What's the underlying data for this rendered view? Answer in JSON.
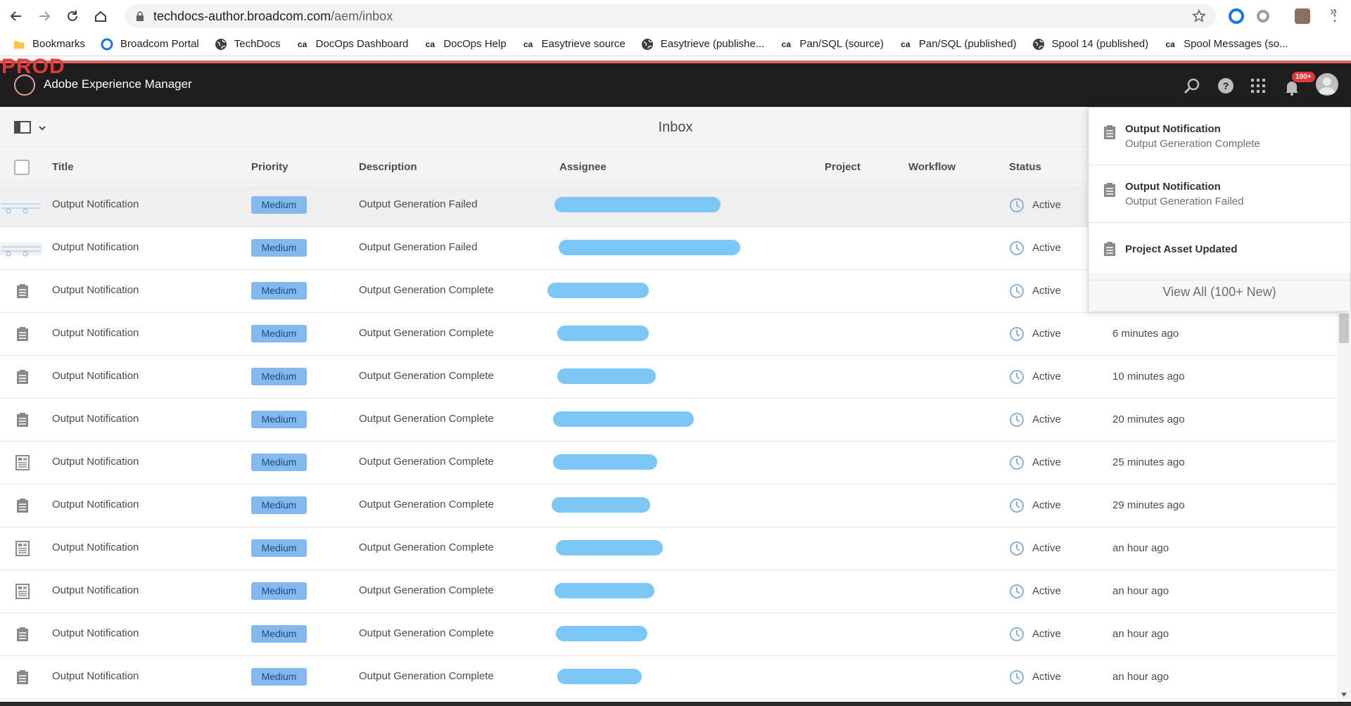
{
  "browser": {
    "url_host": "techdocs-author.broadcom.com",
    "url_path": "/aem/inbox",
    "bookmarks": [
      {
        "label": "Bookmarks",
        "icon": "folder-icon"
      },
      {
        "label": "Broadcom Portal",
        "icon": "broadcom-icon"
      },
      {
        "label": "TechDocs",
        "icon": "globe-icon"
      },
      {
        "label": "DocOps Dashboard",
        "icon": "ca-icon"
      },
      {
        "label": "DocOps Help",
        "icon": "ca-icon"
      },
      {
        "label": "Easytrieve source",
        "icon": "ca-icon"
      },
      {
        "label": "Easytrieve (publishe...",
        "icon": "globe-icon"
      },
      {
        "label": "Pan/SQL (source)",
        "icon": "ca-icon"
      },
      {
        "label": "Pan/SQL (published)",
        "icon": "ca-icon"
      },
      {
        "label": "Spool 14 (published)",
        "icon": "globe-icon"
      },
      {
        "label": "Spool Messages (so...",
        "icon": "ca-icon"
      }
    ],
    "bookmarks_more": "»",
    "ca_glyph": "ca"
  },
  "aem": {
    "env_label": "PROD",
    "product_name": "Adobe Experience Manager",
    "notification_badge": "100+"
  },
  "page": {
    "title": "Inbox"
  },
  "table": {
    "columns": {
      "title": "Title",
      "priority": "Priority",
      "description": "Description",
      "assignee": "Assignee",
      "project": "Project",
      "workflow": "Workflow",
      "status": "Status"
    },
    "rows": [
      {
        "title": "Output Notification",
        "priority": "Medium",
        "description": "Output Generation Failed",
        "status": "Active",
        "time": "",
        "icon": "thumbnail-image"
      },
      {
        "title": "Output Notification",
        "priority": "Medium",
        "description": "Output Generation Failed",
        "status": "Active",
        "time": "",
        "icon": "thumbnail-image"
      },
      {
        "title": "Output Notification",
        "priority": "Medium",
        "description": "Output Generation Complete",
        "status": "Active",
        "time": "",
        "icon": "clipboard-icon"
      },
      {
        "title": "Output Notification",
        "priority": "Medium",
        "description": "Output Generation Complete",
        "status": "Active",
        "time": "6 minutes ago",
        "icon": "clipboard-icon"
      },
      {
        "title": "Output Notification",
        "priority": "Medium",
        "description": "Output Generation Complete",
        "status": "Active",
        "time": "10 minutes ago",
        "icon": "clipboard-icon"
      },
      {
        "title": "Output Notification",
        "priority": "Medium",
        "description": "Output Generation Complete",
        "status": "Active",
        "time": "20 minutes ago",
        "icon": "clipboard-icon"
      },
      {
        "title": "Output Notification",
        "priority": "Medium",
        "description": "Output Generation Complete",
        "status": "Active",
        "time": "25 minutes ago",
        "icon": "document-icon"
      },
      {
        "title": "Output Notification",
        "priority": "Medium",
        "description": "Output Generation Complete",
        "status": "Active",
        "time": "29 minutes ago",
        "icon": "clipboard-icon"
      },
      {
        "title": "Output Notification",
        "priority": "Medium",
        "description": "Output Generation Complete",
        "status": "Active",
        "time": "an hour ago",
        "icon": "document-icon"
      },
      {
        "title": "Output Notification",
        "priority": "Medium",
        "description": "Output Generation Complete",
        "status": "Active",
        "time": "an hour ago",
        "icon": "document-icon"
      },
      {
        "title": "Output Notification",
        "priority": "Medium",
        "description": "Output Generation Complete",
        "status": "Active",
        "time": "an hour ago",
        "icon": "clipboard-icon"
      },
      {
        "title": "Output Notification",
        "priority": "Medium",
        "description": "Output Generation Complete",
        "status": "Active",
        "time": "an hour ago",
        "icon": "clipboard-icon"
      }
    ]
  },
  "notifications": {
    "items": [
      {
        "title": "Output Notification",
        "subtitle": "Output Generation Complete"
      },
      {
        "title": "Output Notification",
        "subtitle": "Output Generation Failed"
      },
      {
        "title": "Project Asset Updated",
        "subtitle": ""
      }
    ],
    "view_all": "View All (100+ New)"
  },
  "colors": {
    "header_bg": "#1e1e1e",
    "prod_red": "#e03a3a",
    "priority_bg": "#84b9ee",
    "redaction": "#7cc7f5"
  }
}
